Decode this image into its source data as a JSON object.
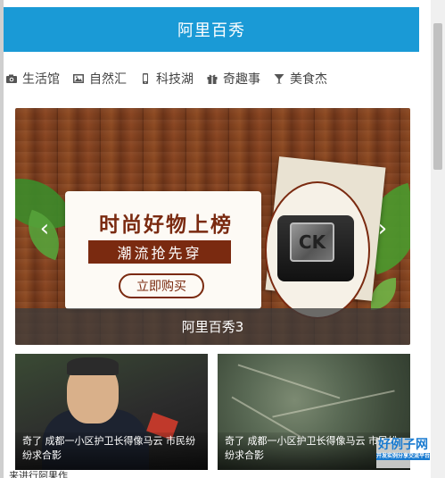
{
  "header": {
    "title": "阿里百秀"
  },
  "nav": {
    "items": [
      {
        "label": "生活馆",
        "icon": "camera-icon"
      },
      {
        "label": "自然汇",
        "icon": "image-icon"
      },
      {
        "label": "科技湖",
        "icon": "phone-icon"
      },
      {
        "label": "奇趣事",
        "icon": "gift-icon"
      },
      {
        "label": "美食杰",
        "icon": "cocktail-icon"
      }
    ]
  },
  "carousel": {
    "headline": "时尚好物上榜",
    "subline": "潮流抢先穿",
    "cta": "立即购买",
    "brand": "CK",
    "caption": "阿里百秀3",
    "prev_glyph": "‹",
    "next_glyph": "›"
  },
  "news": [
    {
      "title": "奇了 成都一小区护卫长得像马云 市民纷纷求合影"
    },
    {
      "title": "奇了 成都一小区护卫长得像马云 市民纷纷求合影"
    }
  ],
  "footer": {
    "cut_text": "来进行阿果作"
  },
  "watermark": {
    "logo": "好例子网",
    "tag": "开发实例分享交流平台"
  },
  "colors": {
    "header_bg": "#1a9ad6",
    "accent": "#7a2a10"
  }
}
